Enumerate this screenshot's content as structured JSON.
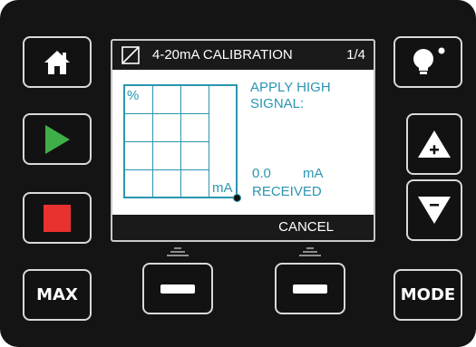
{
  "colors": {
    "panel": "#141414",
    "key_border": "#d9d9d9",
    "lcd_text": "#2b95b0",
    "play": "#3fae49",
    "stop": "#e8322f"
  },
  "keys": {
    "home": {
      "icon": "home-icon"
    },
    "play": {
      "icon": "play-icon"
    },
    "stop": {
      "icon": "stop-icon"
    },
    "max": {
      "label": "MAX"
    },
    "light": {
      "icon": "lightbulb-icon"
    },
    "up": {
      "icon": "up-plus-icon"
    },
    "down": {
      "icon": "down-minus-icon"
    },
    "mode": {
      "label": "MODE"
    },
    "soft_left": {
      "icon": "minus-icon"
    },
    "soft_right": {
      "icon": "minus-icon"
    }
  },
  "display": {
    "title": "4-20mA CALIBRATION",
    "page": "1/4",
    "grid_y_label": "%",
    "grid_x_label": "mA",
    "instruction": "APPLY HIGH SIGNAL:",
    "value": "0.0",
    "unit": "mA",
    "received_label": "RECEIVED",
    "softkey_label": "CANCEL"
  }
}
